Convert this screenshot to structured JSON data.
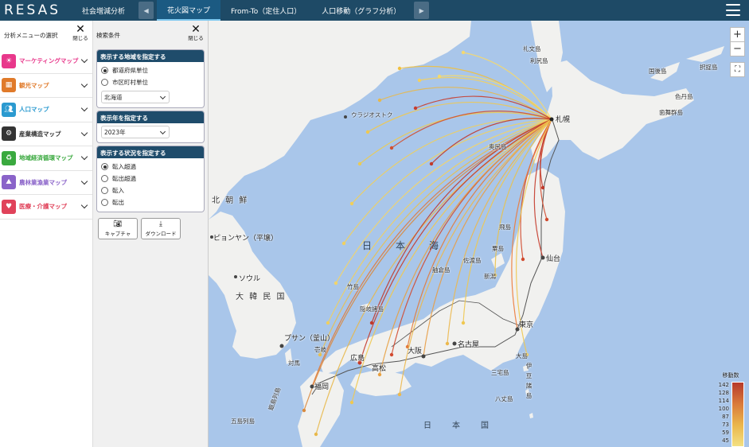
{
  "app": {
    "logo": "RESAS"
  },
  "nav": {
    "tabs": [
      "社会増減分析",
      "花火図マップ",
      "From-To（定住人口）",
      "人口移動（グラフ分析）"
    ],
    "active_tab": "花火図マップ"
  },
  "menu": {
    "title": "分析メニューの選択",
    "close_label": "閉じる",
    "items": [
      {
        "label": "マーケティングマップ",
        "color": "#e8388b"
      },
      {
        "label": "観光マップ",
        "color": "#e07a2a"
      },
      {
        "label": "人口マップ",
        "color": "#2b9ad0"
      },
      {
        "label": "産業構造マップ",
        "color": "#333333"
      },
      {
        "label": "地域経済循環マップ",
        "color": "#3aa93f"
      },
      {
        "label": "農林業漁業マップ",
        "color": "#8a63c9"
      },
      {
        "label": "医療・介護マップ",
        "color": "#e0425a"
      }
    ]
  },
  "search": {
    "title": "検索条件",
    "close_label": "閉じる",
    "region": {
      "title": "表示する地域を指定する",
      "options": [
        "都道府県単位",
        "市区町村単位"
      ],
      "selected": "都道府県単位",
      "prefecture": "北海道"
    },
    "year": {
      "title": "表示年を指定する",
      "value": "2023年"
    },
    "status": {
      "title": "表示する状況を指定する",
      "options": [
        "転入超過",
        "転出超過",
        "転入",
        "転出"
      ],
      "selected": "転入超過"
    },
    "buttons": {
      "capture": "キャプチャ",
      "download": "ダウンロード"
    }
  },
  "map": {
    "zoom_in": "+",
    "zoom_out": "−",
    "labels": {
      "vladivostok": "ウラジオストク",
      "sapporo": "札幌",
      "sendai": "仙台",
      "tokyo": "東京",
      "nagoya": "名古屋",
      "osaka": "大阪",
      "hiroshima": "広島",
      "takamatsu": "高松",
      "fukuoka": "福岡",
      "busan": "プサン（釜山）",
      "seoul": "ソウル",
      "pyongyang": "ピョンヤン（平壌）",
      "north_korea": "北 朝 鮮",
      "south_korea": "大 韓 民 国",
      "sea_of_japan": "日　　本　　海",
      "pacific": "日　　本　　国",
      "niigata": "新潟",
      "rebun": "礼文島",
      "rishiri": "利尻島",
      "kunashiri": "国後島",
      "etorofu": "択捉島",
      "shikotan": "色丹島",
      "habomai": "歯舞群島",
      "okushiri": "奥尻島",
      "tobishima": "飛島",
      "awashima": "粟島",
      "sado": "佐渡島",
      "hegura": "舳倉島",
      "takeshima": "竹島",
      "oki": "隠岐諸島",
      "iki": "壱岐",
      "tsushima": "対馬",
      "goto": "五島列島",
      "koshiki": "甑島列島",
      "oshima": "大島",
      "miyake": "三宅島",
      "hachijo": "八丈島",
      "izu": "伊豆諸島"
    }
  },
  "legend": {
    "title": "移動数",
    "ticks": [
      "142",
      "128",
      "114",
      "100",
      "87",
      "73",
      "59",
      "45"
    ]
  }
}
